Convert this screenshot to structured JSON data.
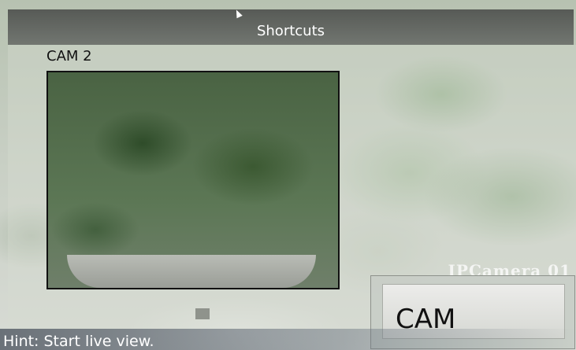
{
  "header": {
    "title": "Shortcuts"
  },
  "preview": {
    "camera_label": "CAM 2"
  },
  "watermark": {
    "text": "IPCamera 01"
  },
  "selected_box": {
    "label": "CAM"
  },
  "hint": {
    "text": "Hint: Start live view."
  },
  "icons": {
    "cursor": "mouse-pointer-icon"
  },
  "colors": {
    "header_bg": "#4e504e",
    "preview_border": "#111111",
    "text_light": "#ffffff"
  }
}
